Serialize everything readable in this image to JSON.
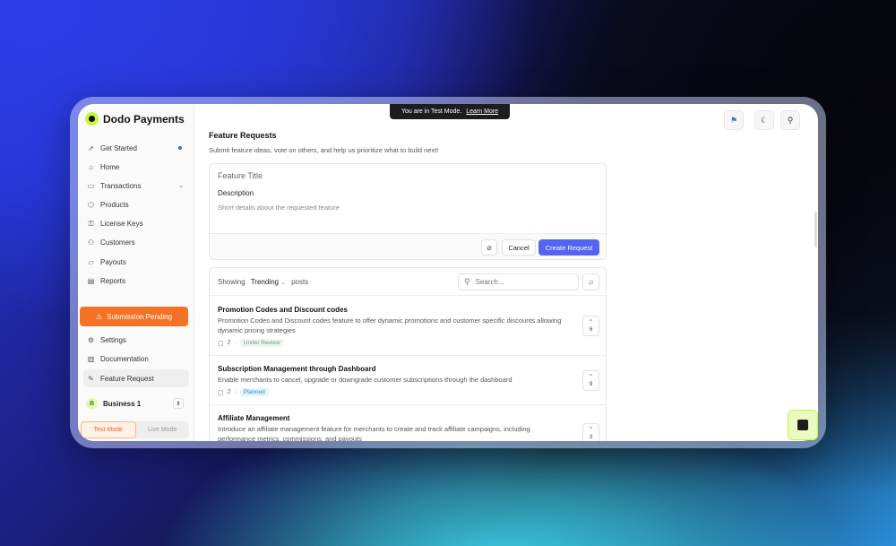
{
  "brand": {
    "name": "Dodo Payments"
  },
  "banner": {
    "text": "You are in Test Mode.",
    "link": "Learn More"
  },
  "sidebar": {
    "items": [
      {
        "label": "Get Started",
        "icon": "rocket-icon"
      },
      {
        "label": "Home",
        "icon": "home-icon"
      },
      {
        "label": "Transactions",
        "icon": "wallet-icon"
      },
      {
        "label": "Products",
        "icon": "box-icon"
      },
      {
        "label": "License Keys",
        "icon": "key-icon"
      },
      {
        "label": "Customers",
        "icon": "users-icon"
      },
      {
        "label": "Payouts",
        "icon": "folder-icon"
      },
      {
        "label": "Reports",
        "icon": "clipboard-icon"
      }
    ],
    "submission_pending": "Submission Pending",
    "bottom_items": [
      {
        "label": "Settings",
        "icon": "gear-icon"
      },
      {
        "label": "Documentation",
        "icon": "book-icon"
      },
      {
        "label": "Feature Request",
        "icon": "edit-icon"
      }
    ],
    "business": {
      "initial": "B",
      "name": "Business 1"
    },
    "modes": {
      "test": "Test Mode",
      "live": "Live Mode"
    }
  },
  "main": {
    "title": "Feature Requests",
    "subtitle": "Submit feature ideas, vote on others, and help us prioritize what to build next!",
    "form": {
      "title_placeholder": "Feature Title",
      "description_label": "Description",
      "description_placeholder": "Short details about the requested feature",
      "cancel": "Cancel",
      "create": "Create Request"
    },
    "list": {
      "showing": "Showing",
      "sort": "Trending",
      "posts": "posts",
      "search_placeholder": "Search...",
      "items": [
        {
          "title": "Promotion Codes and Discount codes",
          "description": "Promotion Codes and Discount codes feature to offer dynamic promotions and customer specific discounts allowing dynamic pricing strategies",
          "comments": "2",
          "status": "Under Review",
          "votes": "6"
        },
        {
          "title": "Subscription Management through Dashboard",
          "description": "Enable merchants to cancel, upgrade or downgrade customer subscriptions through the dashboard",
          "comments": "2",
          "status": "Planned",
          "votes": "9"
        },
        {
          "title": "Affiliate Management",
          "description": "Introduce an affiliate management feature for merchants to create and track affiliate campaigns, including performance metrics, commissions, and payouts",
          "votes": "3"
        }
      ]
    }
  }
}
